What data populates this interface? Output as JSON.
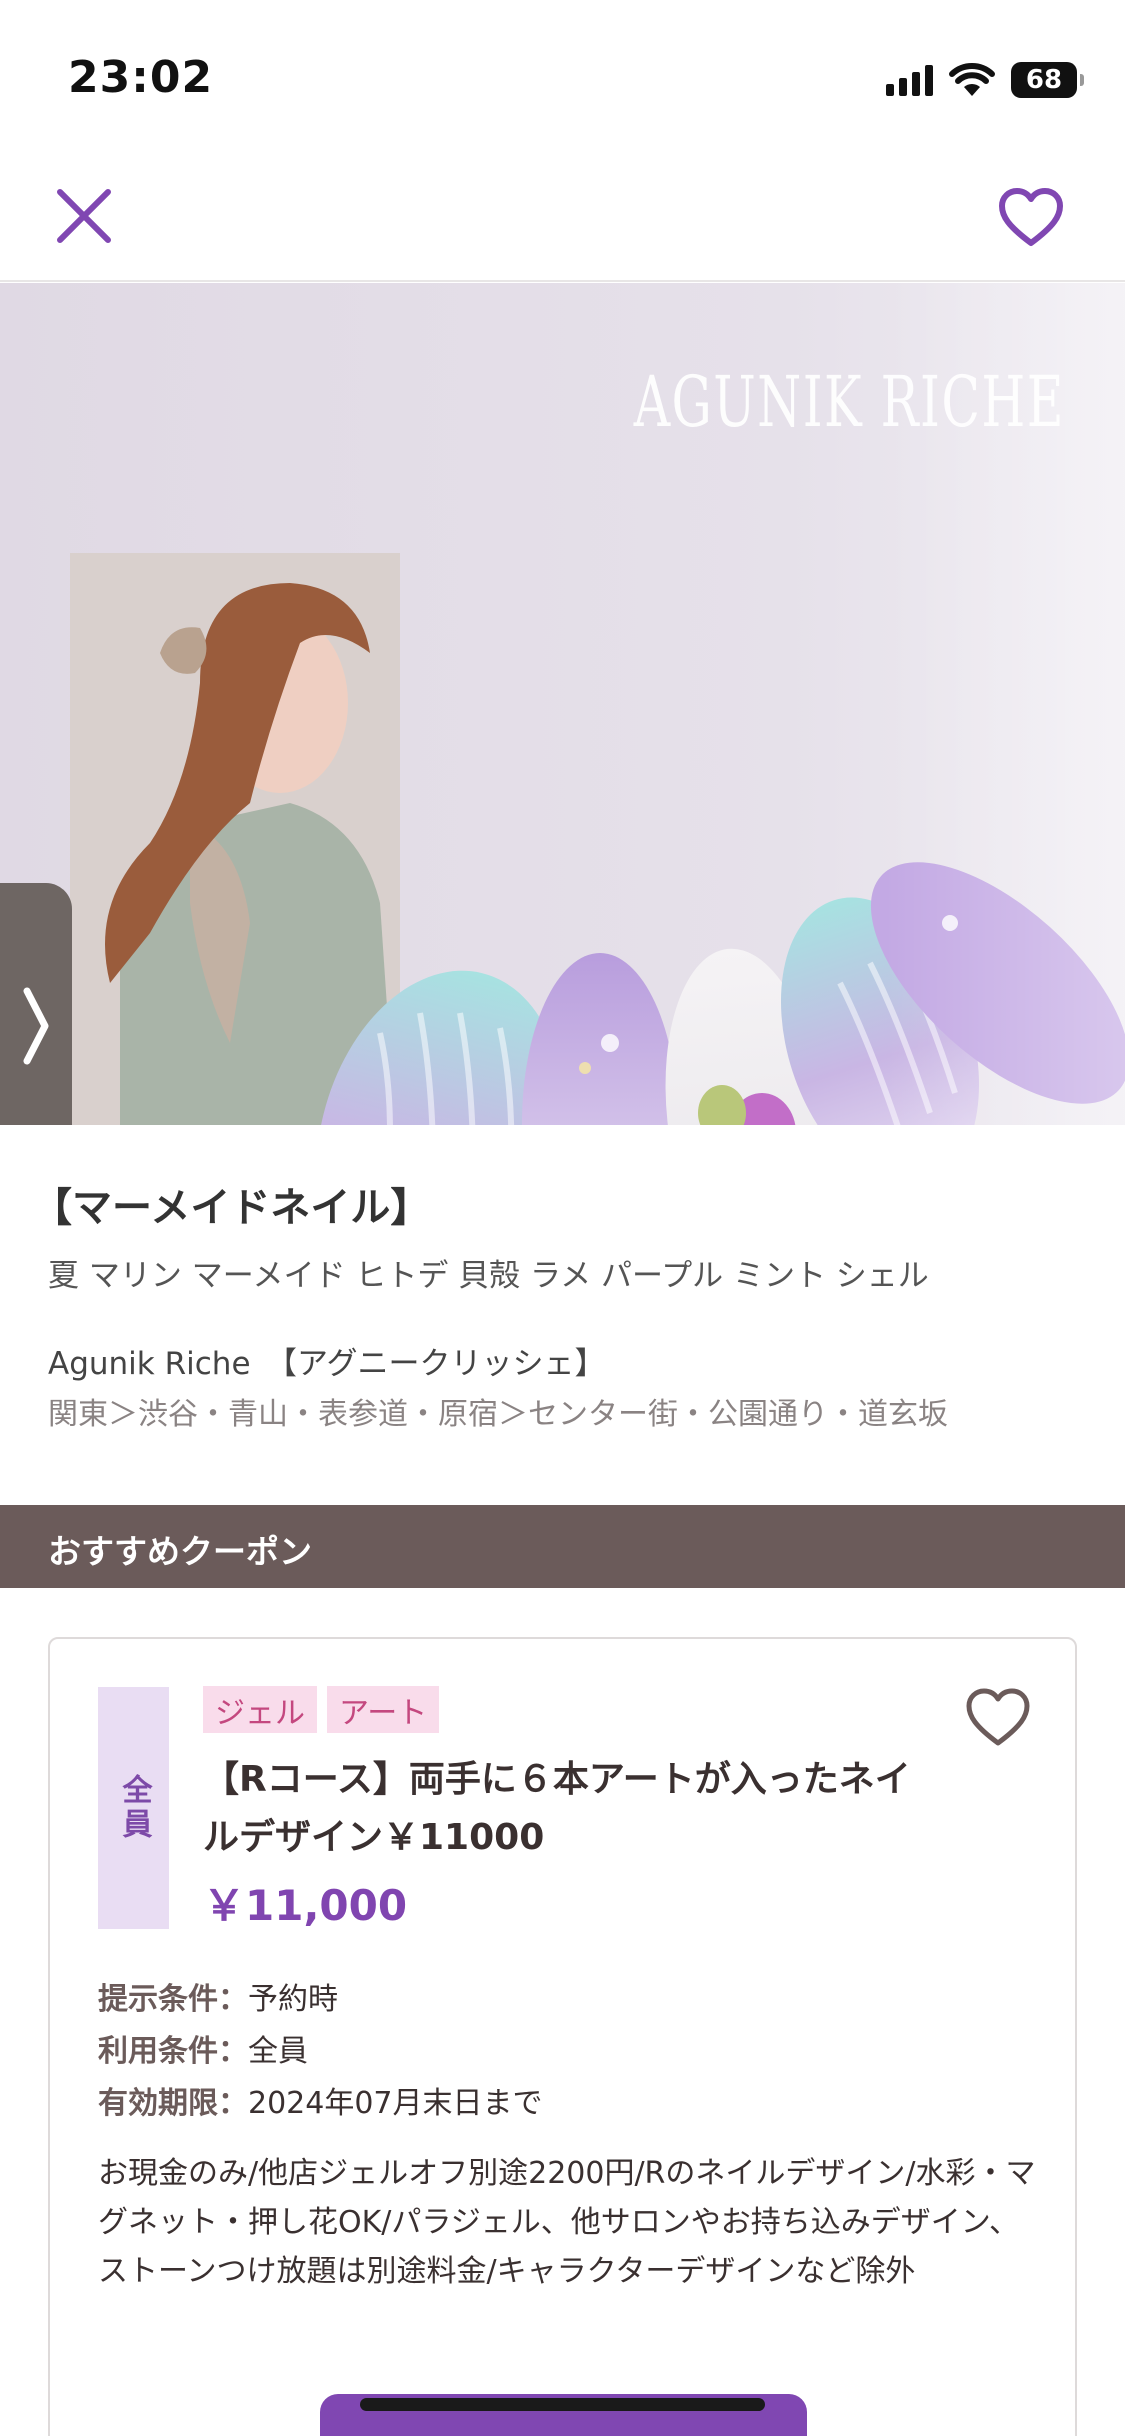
{
  "status_bar": {
    "time": "23:02",
    "battery_level": "68",
    "signal_bars": 4
  },
  "nav": {
    "close_icon": "close-icon",
    "favorite_icon": "heart-outline-icon",
    "accent": "#8047b2"
  },
  "hero": {
    "logo_text": "AGUNIK RICHE",
    "next_icon": "chevron-right-icon"
  },
  "design": {
    "title": "【マーメイドネイル】",
    "tags": "夏 マリン マーメイド ヒトデ 貝殻 ラメ パープル ミント シェル",
    "salon_name": "Agunik Riche　【アグニークリッシェ】",
    "area": "関東＞渋谷・青山・表参道・原宿＞センター街・公園通り・道玄坂"
  },
  "section": {
    "title": "おすすめクーポン",
    "bg_color": "#6b5b5a"
  },
  "coupon": {
    "target": "全員",
    "categories": [
      "ジェル",
      "アート"
    ],
    "title": "【Rコース】両手に６本アートが入ったネイルデザイン￥11000",
    "price": "￥11,000",
    "conditions": [
      {
        "label": "提示条件",
        "value": "予約時"
      },
      {
        "label": "利用条件",
        "value": "全員"
      },
      {
        "label": "有効期限",
        "value": "2024年07月末日まで"
      }
    ],
    "description": "お現金のみ/他店ジェルオフ別途2200円/Rのネイルデザイン/水彩・マグネット・押し花OK/パラジェル、他サロンやお持ち込みデザイン、ストーンつけ放題は別途料金/キャラクターデザインなど除外",
    "price_color": "#8045b0",
    "tag_color": "#c4487f"
  }
}
